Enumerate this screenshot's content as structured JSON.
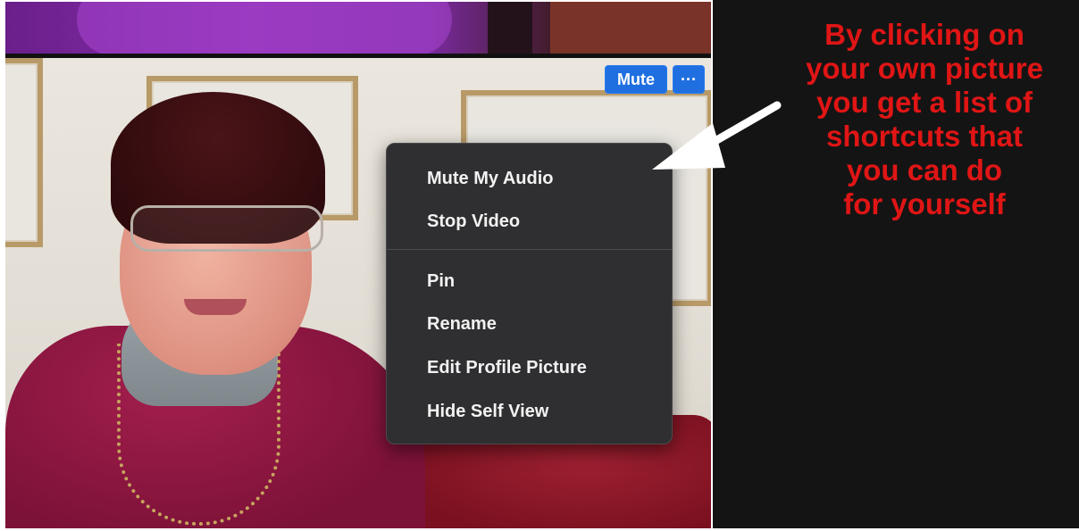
{
  "meeting": {
    "mute_button_label": "Mute",
    "more_button_label": "···"
  },
  "context_menu": {
    "items": [
      {
        "label": "Mute My Audio"
      },
      {
        "label": "Stop Video"
      },
      {
        "label": "Pin"
      },
      {
        "label": "Rename"
      },
      {
        "label": "Edit Profile Picture"
      },
      {
        "label": "Hide Self View"
      }
    ]
  },
  "annotation": {
    "text": "By clicking on\nyour own picture\nyou get a list of\nshortcuts that\nyou can do\nfor yourself",
    "color": "#e01515"
  },
  "colors": {
    "accent_button": "#1f6fe0",
    "menu_background": "#2f2f31",
    "panel_background": "#141414"
  }
}
